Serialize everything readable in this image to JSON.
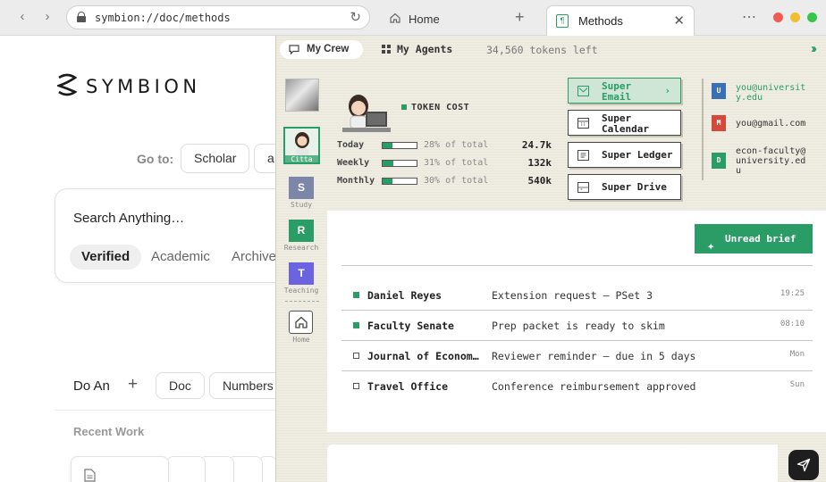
{
  "browser": {
    "url": "symbion://doc/methods",
    "tabs": [
      {
        "label": "Home"
      },
      {
        "label": "Methods"
      }
    ]
  },
  "page": {
    "logo_text": "SYMBION",
    "goto_label": "Go to:",
    "goto_chips": [
      "Scholar",
      "a"
    ],
    "search_placeholder": "Search Anything…",
    "filter_tabs": [
      "Verified",
      "Academic",
      "Archived"
    ],
    "do_label": "Do An",
    "do_chips": [
      "Doc",
      "Numbers"
    ],
    "recent_label": "Recent Work"
  },
  "panel": {
    "crew_label": "My Crew",
    "agents_label": "My Agents",
    "tokens_left": "34,560 tokens left",
    "rail": [
      {
        "letter": "",
        "caption": ""
      },
      {
        "letter": "",
        "caption": "Citta"
      },
      {
        "letter": "S",
        "caption": "Study",
        "color": "#7b86a8"
      },
      {
        "letter": "R",
        "caption": "Research",
        "color": "#2a9d66"
      },
      {
        "letter": "T",
        "caption": "Teaching",
        "color": "#6b63e0"
      },
      {
        "letter": "",
        "caption": "Home"
      }
    ],
    "token_cost": {
      "title": "TOKEN COST",
      "rows": [
        {
          "period": "Today",
          "fraction": 0.28,
          "pct_label": "28% of total",
          "value": "24.7k"
        },
        {
          "period": "Weekly",
          "fraction": 0.31,
          "pct_label": "31% of total",
          "value": "132k"
        },
        {
          "period": "Monthly",
          "fraction": 0.3,
          "pct_label": "30% of total",
          "value": "540k"
        }
      ]
    },
    "services": [
      {
        "line1": "Super",
        "line2": "Email",
        "icon": "mail-icon",
        "active": true
      },
      {
        "line1": "Super",
        "line2": "Calendar",
        "icon": "calendar-icon",
        "active": false
      },
      {
        "line1": "Super Ledger",
        "line2": "",
        "icon": "ledger-icon",
        "active": false
      },
      {
        "line1": "Super Drive",
        "line2": "",
        "icon": "drive-icon",
        "active": false
      }
    ],
    "accounts": [
      {
        "badge": "U",
        "email": "you@university.edu",
        "color": "#3a6fb5",
        "active": true
      },
      {
        "badge": "M",
        "email": "you@gmail.com",
        "color": "#d64a3b",
        "active": false
      },
      {
        "badge": "D",
        "email": "econ-faculty@university.edu",
        "color": "#2a9d66",
        "active": false
      }
    ],
    "brief_button": "Unread brief",
    "messages": [
      {
        "from": "Daniel Reyes",
        "subject": "Extension request — PSet 3",
        "time": "19:25",
        "unread": true
      },
      {
        "from": "Faculty Senate",
        "subject": "Prep packet is ready to skim",
        "time": "08:10",
        "unread": true
      },
      {
        "from": "Journal of Econom…",
        "subject": "Reviewer reminder — due in 5 days",
        "time": "Mon",
        "unread": false
      },
      {
        "from": "Travel Office",
        "subject": "Conference reimbursement approved",
        "time": "Sun",
        "unread": false
      }
    ],
    "accent": "#2a9d66"
  }
}
